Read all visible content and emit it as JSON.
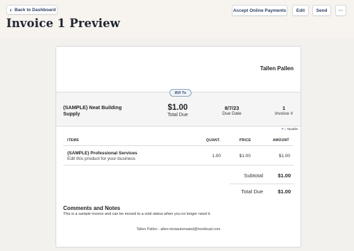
{
  "header": {
    "back_label": "Back to Dashboard",
    "accept_label": "Accept Online Payments",
    "edit_label": "Edit",
    "send_label": "Send",
    "more_label": "···",
    "page_title": "Invoice 1 Preview"
  },
  "invoice": {
    "sender_name": "Tallen Pallen",
    "bill_to_label": "Bill To",
    "client_name": "(SAMPLE) Neat Building Supply",
    "total_amount": "$1.00",
    "total_due_label": "Total Due",
    "due_date": "8/7/23",
    "due_date_label": "Due Date",
    "invoice_number": "1",
    "invoice_number_label": "Invoice #",
    "taxable_symbol": "T",
    "taxable_note": "= Taxable",
    "columns": {
      "items": "ITEMS",
      "quantity": "QUANT.",
      "price": "PRICE",
      "amount": "AMOUNT"
    },
    "line_items": [
      {
        "name": "(SAMPLE) Professional Services",
        "description": "Edit this product for your business",
        "quantity": "1.00",
        "price": "$1.00",
        "amount": "$1.00"
      }
    ],
    "subtotal_label": "Subtotal",
    "subtotal_value": "$1.00",
    "total_due_row_label": "Total Due",
    "total_due_row_value": "$1.00",
    "notes_title": "Comments and Notes",
    "notes_body": "This is a sample invoice and can be moved to a void status when you no longer need it.",
    "footer_text": "Tallen Pallen - allen+testautomated@hooklead.com"
  },
  "colors": {
    "topbar_bg": "#f7f3ee",
    "button_text": "#2b3f63",
    "badge_border": "#8ca3bf"
  }
}
